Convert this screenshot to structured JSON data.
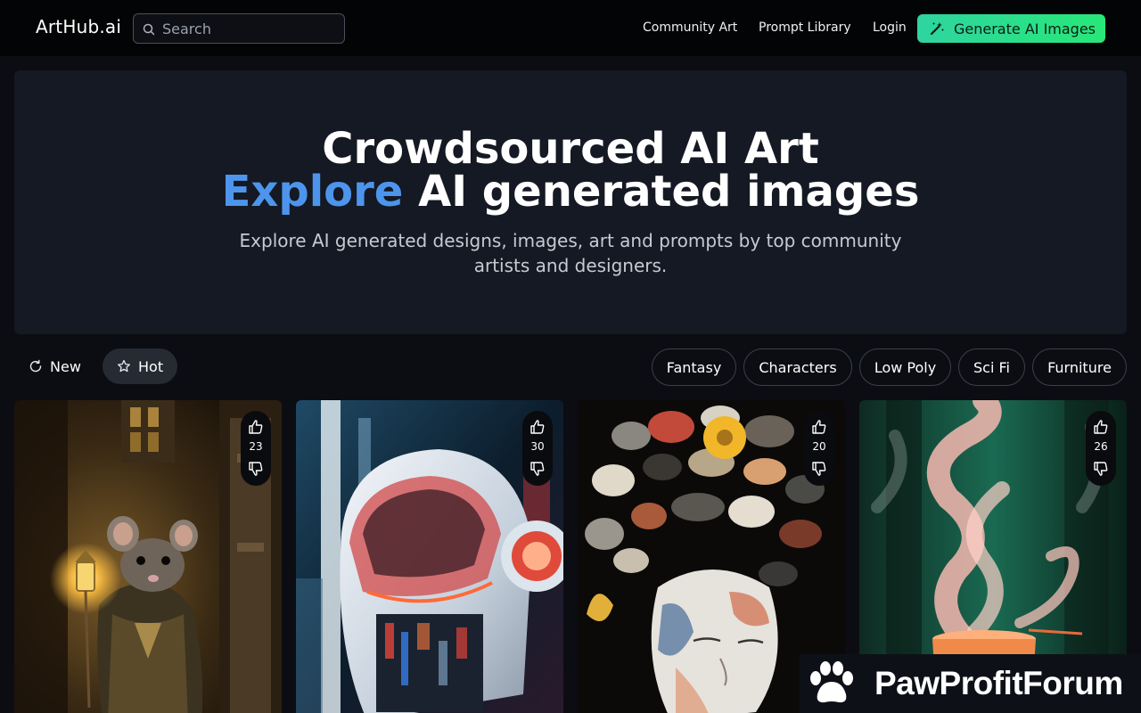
{
  "nav": {
    "logo": "ArtHub.ai",
    "search_placeholder": "Search",
    "links": [
      "Community Art",
      "Prompt Library",
      "Login"
    ],
    "cta": "Generate AI Images"
  },
  "hero": {
    "line1": "Crowdsourced AI Art",
    "line2_accent": "Explore",
    "line2_rest": " AI generated images",
    "subtitle": "Explore AI generated designs, images, art and prompts by top community artists and designers."
  },
  "sort": {
    "new_label": "New",
    "hot_label": "Hot",
    "active": "Hot"
  },
  "tags": [
    "Fantasy",
    "Characters",
    "Low Poly",
    "Sci Fi",
    "Furniture"
  ],
  "cards": [
    {
      "votes": "23",
      "subject": "mouse-with-lantern"
    },
    {
      "votes": "30",
      "subject": "robot-helmet"
    },
    {
      "votes": "20",
      "subject": "stone-head-portrait"
    },
    {
      "votes": "26",
      "subject": "pink-smoke-cup"
    }
  ],
  "watermark": "PawProfitForum",
  "colors": {
    "accent": "#4d95ec",
    "cta_start": "#2fd4a0",
    "cta_end": "#27e878",
    "background": "#0b0d12",
    "hero_bg": "#151923"
  }
}
